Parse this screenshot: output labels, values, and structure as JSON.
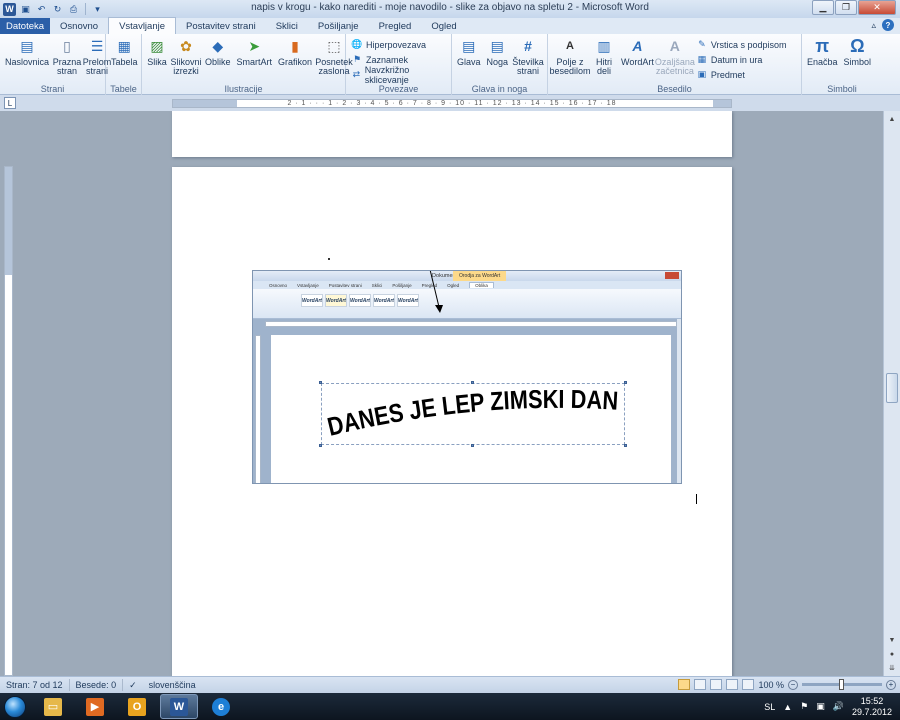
{
  "titlebar": {
    "title": "napis v krogu - kako narediti - moje navodilo - slike za objavo na spletu 2  -  Microsoft Word",
    "quick_access": [
      "save-icon",
      "undo-icon",
      "redo-icon",
      "print-preview-icon",
      "customize-icon"
    ]
  },
  "tabs": {
    "file": "Datoteka",
    "items": [
      "Osnovno",
      "Vstavljanje",
      "Postavitev strani",
      "Sklici",
      "Pošiljanje",
      "Pregled",
      "Ogled"
    ],
    "active": "Vstavljanje"
  },
  "ribbon": {
    "strani": {
      "label": "Strani",
      "buttons": [
        "Naslovnica",
        "Prazna stran",
        "Prelom strani"
      ]
    },
    "tabele": {
      "label": "Tabele",
      "buttons": [
        "Tabela"
      ]
    },
    "ilustracije": {
      "label": "Ilustracije",
      "buttons": [
        "Slika",
        "Slikovni izrezki",
        "Oblike",
        "SmartArt",
        "Grafikon",
        "Posnetek zaslona"
      ]
    },
    "povezave": {
      "label": "Povezave",
      "buttons": [
        "Hiperpovezava",
        "Zaznamek",
        "Navzkrižno sklicevanje"
      ]
    },
    "glava": {
      "label": "Glava in noga",
      "buttons": [
        "Glava",
        "Noga",
        "Številka strani"
      ]
    },
    "besedilo": {
      "label": "Besedilo",
      "buttons": [
        "Polje z besedilom",
        "Hitri deli",
        "WordArt",
        "Ozaljšana začetnica"
      ],
      "side": [
        "Vrstica s podpisom",
        "Datum in ura",
        "Predmet"
      ]
    },
    "simboli": {
      "label": "Simboli",
      "buttons": [
        "Enačba",
        "Simbol"
      ]
    }
  },
  "ruler": {
    "ticks": "2 · 1 · · · 1 · 2 · 3 · 4 · 5 · 6 · 7 · 8 · 9 · 10 · 11 · 12 · 13 · 14 · 15 · 16 · 17 · 18"
  },
  "embedded": {
    "title": "Dokument1 - Microsoft Word",
    "context_tab": "Orodja za WordArt",
    "tabs": [
      "Osnovno",
      "Vstavljanje",
      "Postavitev strani",
      "Sklici",
      "Pošiljanje",
      "Pregled",
      "Ogled",
      "Oblika"
    ],
    "wordart_text": "DANES JE LEP ZIMSKI DAN",
    "gallery_label": "WordArt"
  },
  "status": {
    "page": "Stran: 7 od 12",
    "words": "Besede: 0",
    "language": "slovenščina",
    "zoom": "100 %",
    "zoom_level": 1.0
  },
  "taskbar": {
    "apps": [
      "explorer-icon",
      "media-player-icon",
      "outlook-icon",
      "word-icon",
      "internet-explorer-icon"
    ],
    "lang": "SL",
    "time": "15:52",
    "date": "29.7.2012"
  }
}
